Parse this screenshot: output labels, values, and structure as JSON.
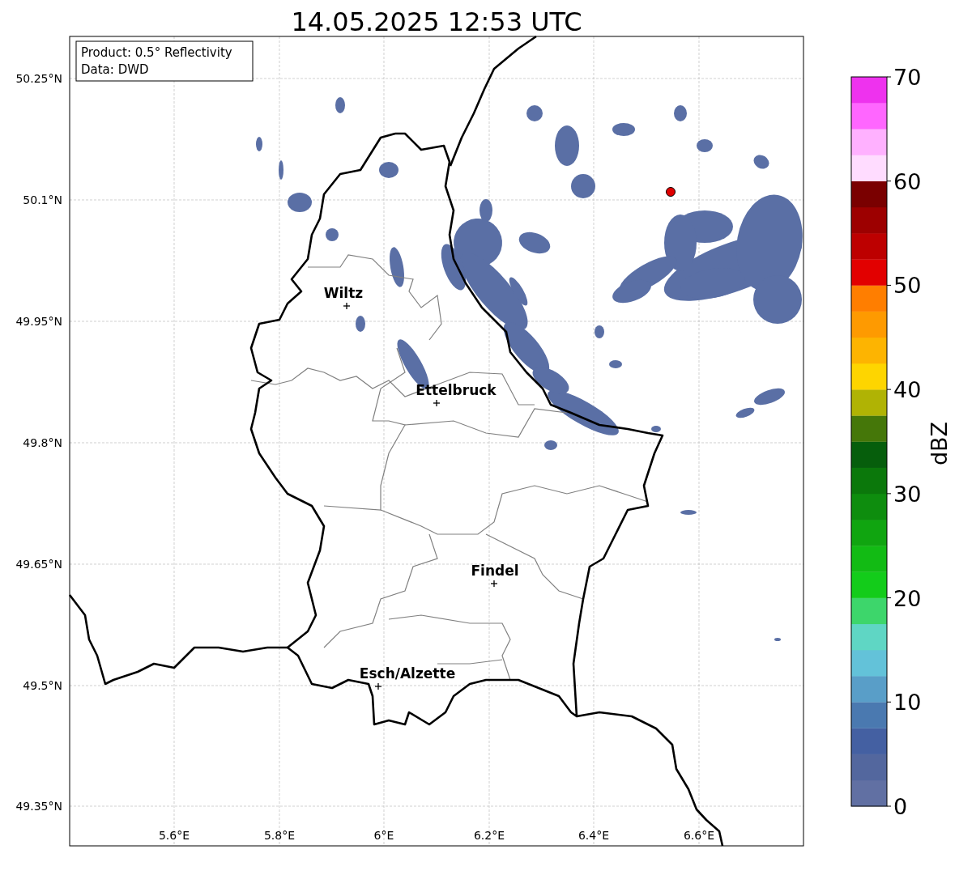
{
  "title": "14.05.2025 12:53 UTC",
  "info_box": {
    "lines": [
      "Product: 0.5° Reflectivity",
      "Data: DWD"
    ]
  },
  "map": {
    "x_ticks": [
      "5.6°E",
      "5.8°E",
      "6°E",
      "6.2°E",
      "6.4°E",
      "6.6°E"
    ],
    "y_ticks": [
      "50.25°N",
      "50.1°N",
      "49.95°N",
      "49.8°N",
      "49.65°N",
      "49.5°N",
      "49.35°N"
    ],
    "cities": [
      {
        "name": "Wiltz"
      },
      {
        "name": "Ettelbruck"
      },
      {
        "name": "Findel"
      },
      {
        "name": "Esch/Alzette"
      }
    ]
  },
  "colorbar": {
    "label": "dBZ",
    "ticks": [
      "70",
      "60",
      "50",
      "40",
      "30",
      "20",
      "10",
      "0"
    ],
    "segments": [
      {
        "color": "#6170a3"
      },
      {
        "color": "#53679e"
      },
      {
        "color": "#4460a2"
      },
      {
        "color": "#4a79b0"
      },
      {
        "color": "#599ec8"
      },
      {
        "color": "#63c2d9"
      },
      {
        "color": "#5fd6c4"
      },
      {
        "color": "#3dd66b"
      },
      {
        "color": "#13cc1a"
      },
      {
        "color": "#12bb14"
      },
      {
        "color": "#10a510"
      },
      {
        "color": "#0e8d0e"
      },
      {
        "color": "#0b780b"
      },
      {
        "color": "#065e0c"
      },
      {
        "color": "#457709"
      },
      {
        "color": "#b0b304"
      },
      {
        "color": "#fed500"
      },
      {
        "color": "#fdb401"
      },
      {
        "color": "#fe9a01"
      },
      {
        "color": "#ff7e00"
      },
      {
        "color": "#e20000"
      },
      {
        "color": "#bd0000"
      },
      {
        "color": "#9d0000"
      },
      {
        "color": "#7a0000"
      },
      {
        "color": "#ffdcff"
      },
      {
        "color": "#ffb1ff"
      },
      {
        "color": "#ff66ff"
      },
      {
        "color": "#ee32ee"
      }
    ]
  }
}
